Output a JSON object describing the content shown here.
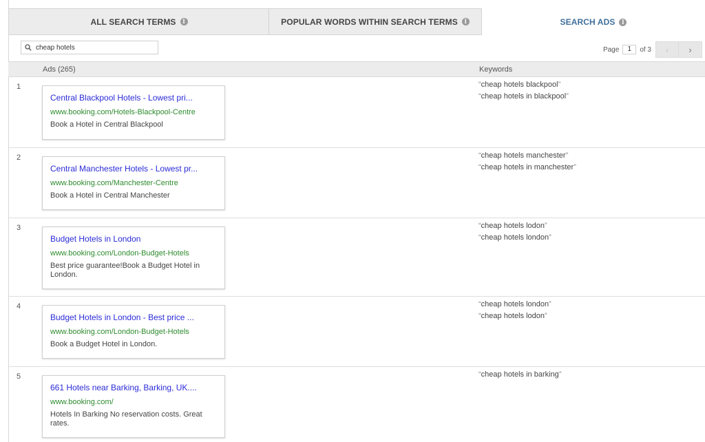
{
  "tabs": [
    {
      "label": "ALL SEARCH TERMS"
    },
    {
      "label": "POPULAR WORDS WITHIN SEARCH TERMS"
    },
    {
      "label": "SEARCH ADS"
    }
  ],
  "search": {
    "value": "cheap hotels"
  },
  "pager": {
    "page_label": "Page",
    "page": "1",
    "of_label": "of 3"
  },
  "columns": {
    "ads": "Ads (265)",
    "keywords": "Keywords"
  },
  "rows": [
    {
      "num": "1",
      "title": "Central Blackpool Hotels - Lowest pri...",
      "url": "www.booking.com/Hotels-Blackpool-Centre",
      "desc": "Book a Hotel in Central Blackpool",
      "keywords": [
        "cheap hotels blackpool",
        "cheap hotels in blackpool"
      ]
    },
    {
      "num": "2",
      "title": "Central Manchester Hotels - Lowest pr...",
      "url": "www.booking.com/Manchester-Centre",
      "desc": "Book a Hotel in Central Manchester",
      "keywords": [
        "cheap hotels manchester",
        "cheap hotels in manchester"
      ]
    },
    {
      "num": "3",
      "title": "Budget Hotels in London",
      "url": "www.booking.com/London-Budget-Hotels",
      "desc": "Best price guarantee!Book a Budget Hotel in London.",
      "keywords": [
        "cheap hotels lodon",
        "cheap hotels london"
      ]
    },
    {
      "num": "4",
      "title": "Budget Hotels in London - Best price ...",
      "url": "www.booking.com/London-Budget-Hotels",
      "desc": "Book a Budget Hotel in London.",
      "keywords": [
        "cheap hotels london",
        "cheap hotels lodon"
      ]
    },
    {
      "num": "5",
      "title": "661 Hotels near Barking, Barking, UK....",
      "url": "www.booking.com/",
      "desc": "Hotels In Barking No reservation costs. Great rates.",
      "keywords": [
        "cheap hotels in barking"
      ]
    }
  ]
}
